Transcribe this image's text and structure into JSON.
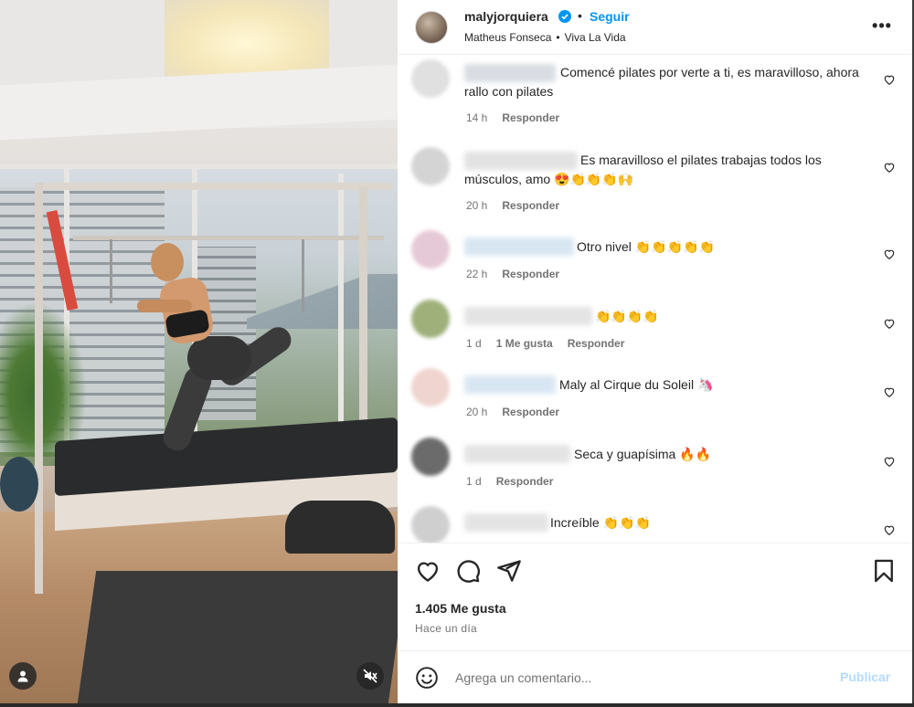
{
  "post": {
    "username": "malyjorquiera",
    "follow_label": "Seguir",
    "separator": "•",
    "subtitle_user": "Matheus Fonseca",
    "subtitle_sep": "•",
    "subtitle_audio": "Viva La Vida",
    "more_label": "•••",
    "likes": "1.405 Me gusta",
    "time_ago": "Hace un día"
  },
  "colors": {
    "accent": "#0095f6",
    "publish_disabled": "#b3dbff",
    "text": "#262626",
    "muted": "#737373"
  },
  "comments": [
    {
      "text": "Comencé pilates por verte a ti, es maravilloso, ahora rallo con pilates",
      "time": "14 h",
      "likes": "",
      "reply": "Responder"
    },
    {
      "text": "Es maravilloso el pilates trabajas todos los músculos, amo 😍👏👏👏🙌",
      "time": "20 h",
      "likes": "",
      "reply": "Responder"
    },
    {
      "text": "Otro nivel 👏👏👏👏👏",
      "time": "22 h",
      "likes": "",
      "reply": "Responder"
    },
    {
      "text": "👏👏👏👏",
      "time": "1 d",
      "likes": "1 Me gusta",
      "reply": "Responder"
    },
    {
      "text": "Maly al Cirque du Soleil 🦄",
      "time": "20 h",
      "likes": "",
      "reply": "Responder"
    },
    {
      "text": "Seca y guapísima 🔥🔥",
      "time": "1 d",
      "likes": "",
      "reply": "Responder"
    },
    {
      "text": "Increíble 👏👏👏",
      "time": "",
      "likes": "",
      "reply": ""
    }
  ],
  "composer": {
    "placeholder": "Agrega un comentario...",
    "publish_label": "Publicar"
  },
  "icons": {
    "header": [
      "verified-badge-icon",
      "more-options-icon"
    ],
    "actions": [
      "heart-icon",
      "comment-icon",
      "share-icon",
      "bookmark-icon"
    ],
    "media": [
      "user-tag-icon",
      "mute-icon"
    ],
    "composer": [
      "emoji-icon"
    ]
  }
}
